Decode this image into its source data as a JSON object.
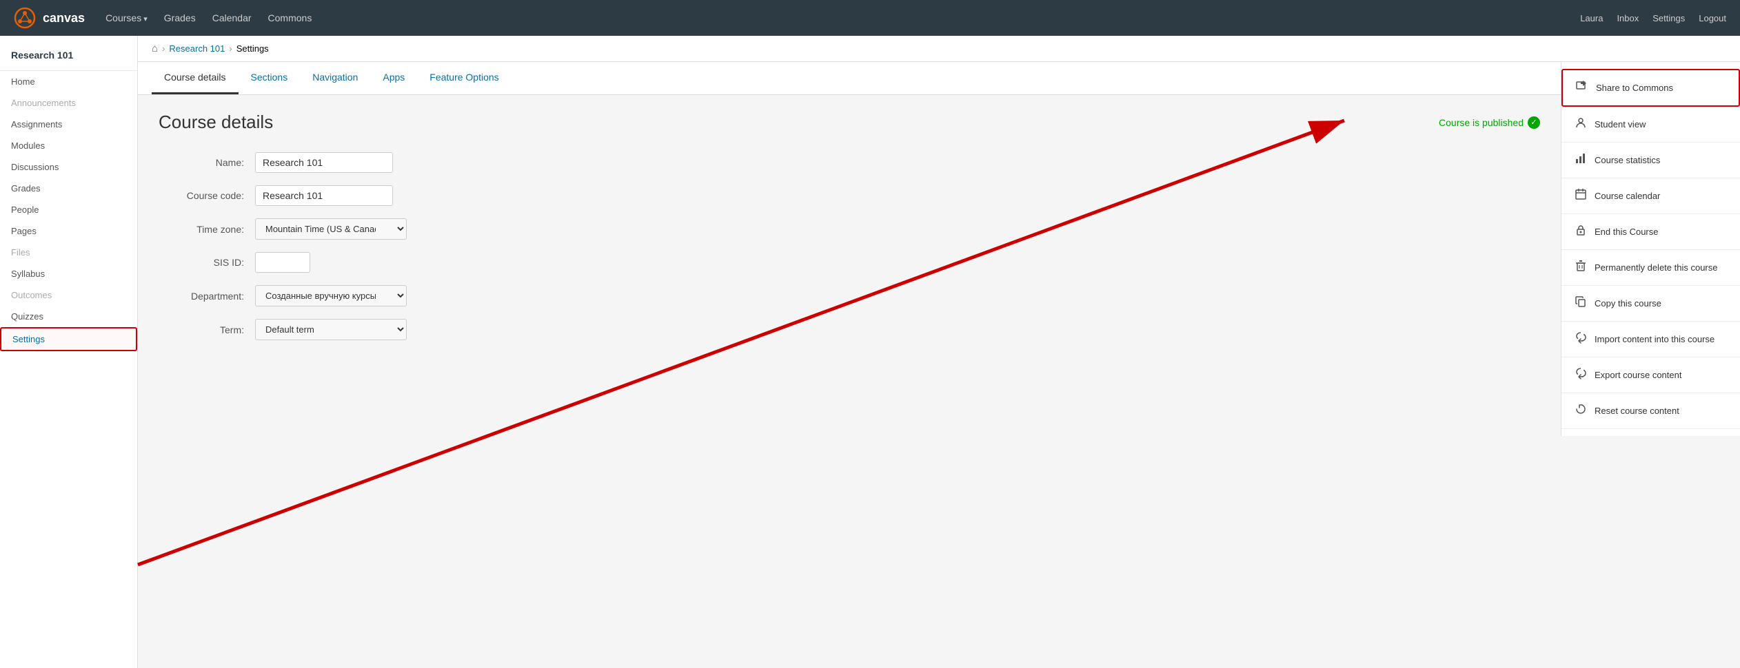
{
  "topNav": {
    "logo": "canvas",
    "logoIcon": "●",
    "navItems": [
      {
        "label": "Courses",
        "hasArrow": true
      },
      {
        "label": "Grades",
        "hasArrow": false
      },
      {
        "label": "Calendar",
        "hasArrow": false
      },
      {
        "label": "Commons",
        "hasArrow": false
      }
    ],
    "userItems": [
      "Laura",
      "Inbox",
      "Settings",
      "Logout"
    ]
  },
  "sidebar": {
    "courseTitle": "Research 101",
    "items": [
      {
        "label": "Home",
        "id": "home",
        "active": false,
        "disabled": false
      },
      {
        "label": "Announcements",
        "id": "announcements",
        "active": false,
        "disabled": true
      },
      {
        "label": "Assignments",
        "id": "assignments",
        "active": false,
        "disabled": false
      },
      {
        "label": "Modules",
        "id": "modules",
        "active": false,
        "disabled": false
      },
      {
        "label": "Discussions",
        "id": "discussions",
        "active": false,
        "disabled": false
      },
      {
        "label": "Grades",
        "id": "grades",
        "active": false,
        "disabled": false
      },
      {
        "label": "People",
        "id": "people",
        "active": false,
        "disabled": false
      },
      {
        "label": "Pages",
        "id": "pages",
        "active": false,
        "disabled": false
      },
      {
        "label": "Files",
        "id": "files",
        "active": false,
        "disabled": true
      },
      {
        "label": "Syllabus",
        "id": "syllabus",
        "active": false,
        "disabled": false
      },
      {
        "label": "Outcomes",
        "id": "outcomes",
        "active": false,
        "disabled": true
      },
      {
        "label": "Quizzes",
        "id": "quizzes",
        "active": false,
        "disabled": false
      },
      {
        "label": "Settings",
        "id": "settings",
        "active": true,
        "disabled": false
      }
    ]
  },
  "breadcrumb": {
    "homeLabel": "⌂",
    "items": [
      {
        "label": "Research 101",
        "link": true
      },
      {
        "label": "Settings",
        "link": false
      }
    ]
  },
  "tabs": [
    {
      "label": "Course details",
      "active": true
    },
    {
      "label": "Sections",
      "active": false
    },
    {
      "label": "Navigation",
      "active": false
    },
    {
      "label": "Apps",
      "active": false
    },
    {
      "label": "Feature Options",
      "active": false
    }
  ],
  "courseDetails": {
    "title": "Course details",
    "publishedLabel": "Course is published",
    "form": {
      "nameLabel": "Name:",
      "nameValue": "Research 101",
      "courseCodeLabel": "Course code:",
      "courseCodeValue": "Research 101",
      "timezoneLabel": "Time zone:",
      "timezoneValue": "Mountain Time (US & Canada)",
      "sisIdLabel": "SIS ID:",
      "sisIdValue": "",
      "departmentLabel": "Department:",
      "departmentValue": "Созданные вручную курсы",
      "termLabel": "Term:",
      "termValue": "Default term"
    }
  },
  "rightSidebar": {
    "items": [
      {
        "id": "share-commons",
        "icon": "↗",
        "label": "Share to Commons",
        "highlighted": true
      },
      {
        "id": "student-view",
        "icon": "👤",
        "label": "Student view",
        "highlighted": false
      },
      {
        "id": "course-statistics",
        "icon": "📊",
        "label": "Course statistics",
        "highlighted": false
      },
      {
        "id": "course-calendar",
        "icon": "📅",
        "label": "Course calendar",
        "highlighted": false
      },
      {
        "id": "end-course",
        "icon": "🔒",
        "label": "End this Course",
        "highlighted": false
      },
      {
        "id": "delete-course",
        "icon": "🗑",
        "label": "Permanently delete this course",
        "highlighted": false
      },
      {
        "id": "copy-course",
        "icon": "📋",
        "label": "Copy this course",
        "highlighted": false
      },
      {
        "id": "import-content",
        "icon": "☁",
        "label": "Import content into this course",
        "highlighted": false
      },
      {
        "id": "export-content",
        "icon": "☁",
        "label": "Export course content",
        "highlighted": false
      },
      {
        "id": "reset-content",
        "icon": "↺",
        "label": "Reset course content",
        "highlighted": false
      }
    ]
  }
}
